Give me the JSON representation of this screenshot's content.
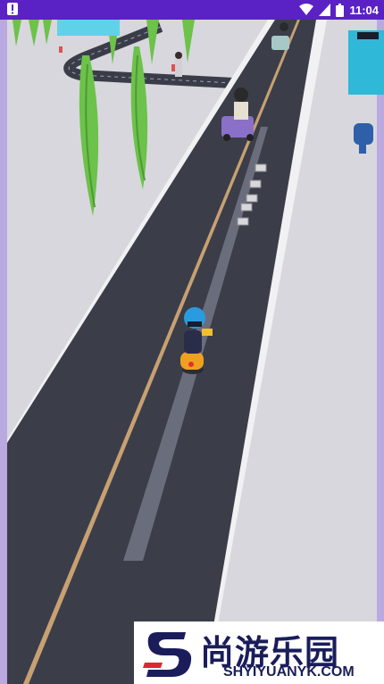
{
  "status_bar": {
    "time": "11:04",
    "icons": [
      "alert-icon",
      "wifi-icon",
      "signal-icon",
      "battery-icon"
    ]
  },
  "game": {
    "scene": "runner-road",
    "colors": {
      "road": "#3a3d48",
      "lane_line": "#c8a072",
      "sidewalk": "#e7e7ea",
      "grass_area": "#d6d6dc",
      "status_bar": "#5a22c4",
      "tree": "#6cc24a",
      "player_helmet": "#2b9be0"
    }
  },
  "watermark": {
    "chinese_text": "尚游乐园",
    "english_text": "SHYIYUANYK.COM",
    "logo_letter": "S",
    "brand_color": "#1a1d5a",
    "accent_color": "#e0272b"
  }
}
